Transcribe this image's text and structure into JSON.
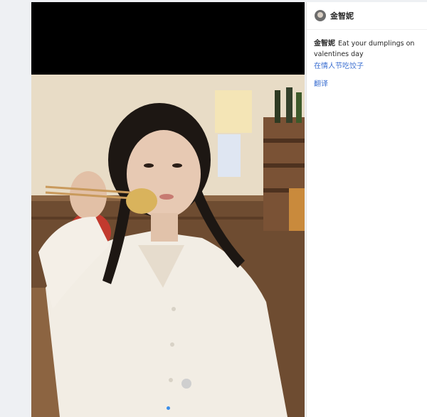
{
  "post": {
    "username": "金智妮",
    "caption_author": "金智妮",
    "caption_text": "Eat your dumplings on valentines day",
    "tag_link": "在情人节吃饺子",
    "translate": "翻译"
  },
  "media": {
    "subject": "Woman in white shirt with braided hair holding a dumpling with chopsticks in a restaurant",
    "carousel_dots": 1
  },
  "colors": {
    "link": "#3b6fd1",
    "accent": "#3b8eea"
  }
}
